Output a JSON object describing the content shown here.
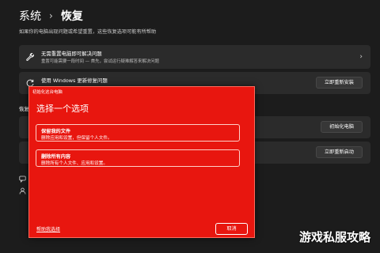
{
  "breadcrumb": {
    "parent": "系统",
    "separator": "›",
    "current": "恢复"
  },
  "subtitle": "如果你的电脑出现问题或希望重置，这些恢复选项可能有所帮助",
  "cards": {
    "fix_problems": {
      "title": "无需重置电脑即可解决问题",
      "desc": "重置可能需要一段时间 — 首先，尝试运行疑难解答来解决问题",
      "chevron": "›"
    },
    "windows_update": {
      "title": "使用 Windows 更新修复问题",
      "button": "立即重新安装"
    },
    "reset_pc": {
      "button": "初始化电脑"
    },
    "advanced_startup": {
      "button": "立即重新启动"
    }
  },
  "section_label": "恢复",
  "dialog": {
    "caption": "初始化这台电脑",
    "heading": "选择一个选项",
    "options": [
      {
        "title": "保留我的文件",
        "desc": "删除应用和设置，但保留个人文件。"
      },
      {
        "title": "删除所有内容",
        "desc": "删除所有个人文件、应用和设置。"
      }
    ],
    "help_link": "帮助我选择",
    "cancel": "取消"
  },
  "watermark": "游戏私服攻略",
  "colors": {
    "dialog_bg": "#e8160f",
    "page_bg": "#1c1c1c",
    "card_bg": "#2b2b2b"
  },
  "icons": [
    "wrench-icon",
    "refresh-icon",
    "chevron-right-icon",
    "feedback-icon",
    "person-icon"
  ]
}
